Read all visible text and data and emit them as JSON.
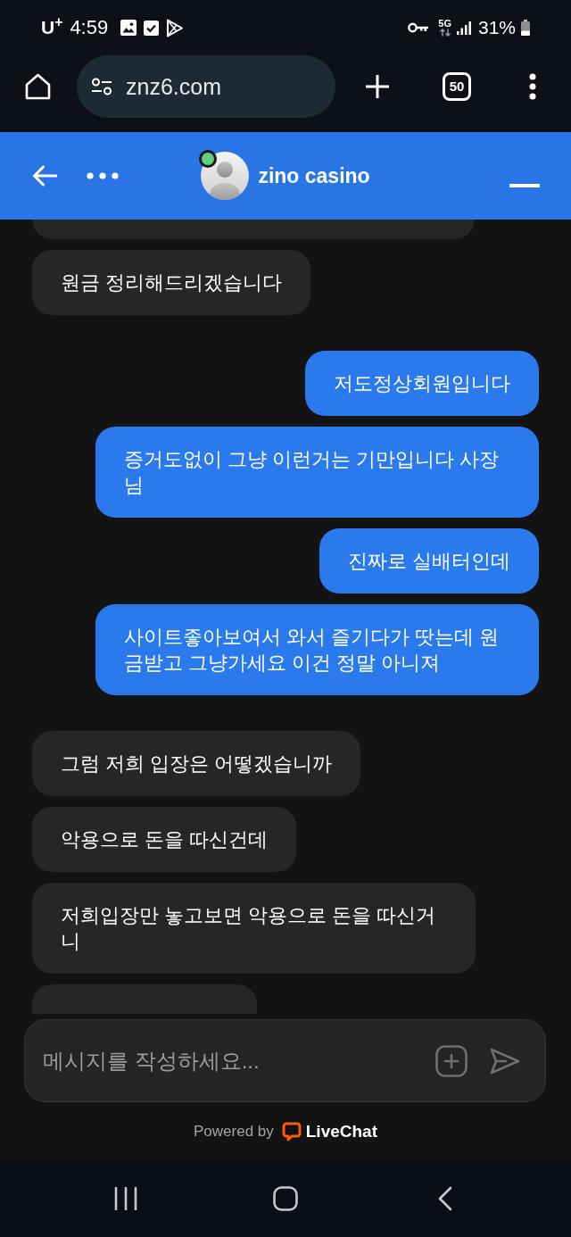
{
  "status_bar": {
    "carrier": "U$^{+}$",
    "time": "4:59",
    "network": "5G",
    "battery": "31%"
  },
  "browser_toolbar": {
    "url": "znz6.com",
    "tab_count": "50"
  },
  "chat_header": {
    "title": "zino casino",
    "agent_online": true
  },
  "messages": [
    {
      "kind": "incoming",
      "clipped": true
    },
    {
      "kind": "incoming",
      "clipped": false,
      "text": "원금 정리해드리겠습니다"
    },
    {
      "kind": "outgoing",
      "clipped": false,
      "text": "저도정상회원입니다"
    },
    {
      "kind": "outgoing",
      "clipped": false,
      "text": "증거도없이 그냥 이런거는 기만입니다 사장님"
    },
    {
      "kind": "outgoing",
      "clipped": false,
      "text": "진짜로 실배터인데"
    },
    {
      "kind": "outgoing",
      "clipped": false,
      "text": "사이트좋아보여서 와서 즐기다가 땃는데 원금받고 그냥가세요 이건 정말 아니져"
    },
    {
      "kind": "incoming",
      "clipped": false,
      "text": "그럼 저희 입장은 어떻겠습니까"
    },
    {
      "kind": "incoming",
      "clipped": false,
      "text": "악용으로 돈을 따신건데"
    },
    {
      "kind": "incoming",
      "clipped": false,
      "text": "저희입장만 놓고보면 악용으로 돈을 따신거니"
    },
    {
      "kind": "incoming",
      "clipped": true
    }
  ],
  "composer": {
    "placeholder": "메시지를 작성하세요..."
  },
  "footer": {
    "prefix": "Powered by",
    "brand": "LiveChat"
  }
}
